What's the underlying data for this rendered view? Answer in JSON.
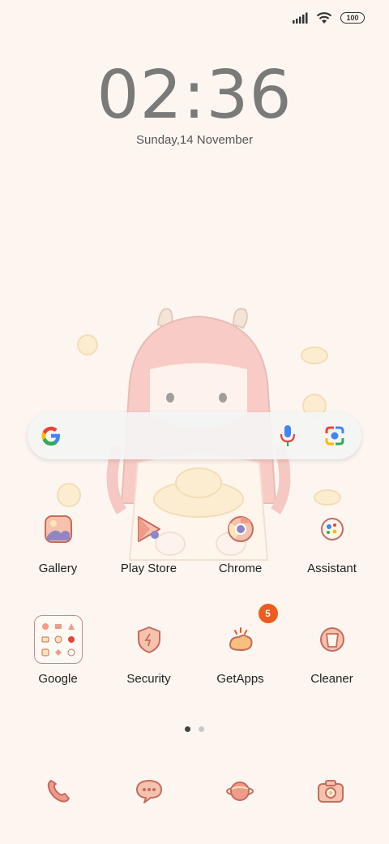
{
  "status_bar": {
    "battery": "100",
    "signal_icon": "signal-icon",
    "wifi_icon": "wifi-icon"
  },
  "lock": {
    "time": "02:36",
    "date": "Sunday,14 November"
  },
  "search_bar": {
    "google_icon": "google-logo-icon",
    "mic_icon": "mic-icon",
    "lens_icon": "lens-icon"
  },
  "apps_row1": [
    {
      "label": "Gallery",
      "icon": "gallery-icon"
    },
    {
      "label": "Play Store",
      "icon": "play-store-icon"
    },
    {
      "label": "Chrome",
      "icon": "chrome-icon"
    },
    {
      "label": "Assistant",
      "icon": "assistant-icon"
    }
  ],
  "apps_row2": [
    {
      "label": "Google",
      "icon": "google-folder-icon"
    },
    {
      "label": "Security",
      "icon": "security-icon"
    },
    {
      "label": "GetApps",
      "icon": "getapps-icon",
      "badge": "5"
    },
    {
      "label": "Cleaner",
      "icon": "cleaner-icon"
    }
  ],
  "page_indicator": {
    "pages": 2,
    "active": 1
  },
  "dock": [
    {
      "icon": "phone-icon"
    },
    {
      "icon": "messages-icon"
    },
    {
      "icon": "browser-icon"
    },
    {
      "icon": "camera-icon"
    }
  ],
  "colors": {
    "background": "#fdf6f0",
    "icon_fill": "#f5c2ad",
    "icon_stroke": "#c66b5f",
    "badge": "#ef5a1d"
  }
}
